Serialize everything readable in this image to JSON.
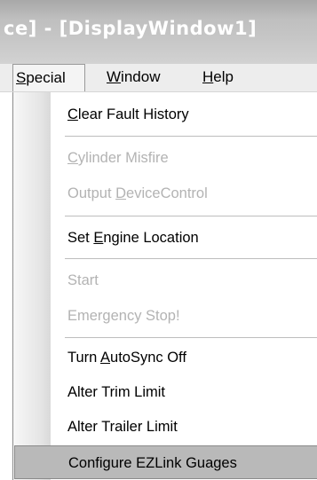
{
  "window": {
    "title": "ce] - [DisplayWindow1]"
  },
  "menubar": {
    "items": [
      {
        "pre": "",
        "ul": "S",
        "post": "pecial"
      },
      {
        "pre": "",
        "ul": "W",
        "post": "indow"
      },
      {
        "pre": "",
        "ul": "H",
        "post": "elp"
      }
    ]
  },
  "menu": {
    "items": [
      {
        "pre": "",
        "ul": "C",
        "post": "lear Fault History",
        "enabled": true
      },
      {
        "pre": "",
        "ul": "C",
        "post": "ylinder Misfire",
        "enabled": false
      },
      {
        "pre": "Output ",
        "ul": "D",
        "post": "eviceControl",
        "enabled": false
      },
      {
        "pre": "Set ",
        "ul": "E",
        "post": "ngine Location",
        "enabled": true
      },
      {
        "pre": "",
        "ul": "",
        "post": "Start",
        "enabled": false
      },
      {
        "pre": "",
        "ul": "",
        "post": "Emergency Stop!",
        "enabled": false
      },
      {
        "pre": "Turn ",
        "ul": "A",
        "post": "utoSync Off",
        "enabled": true
      },
      {
        "pre": "",
        "ul": "",
        "post": "Alter Trim Limit",
        "enabled": true
      },
      {
        "pre": "",
        "ul": "",
        "post": "Alter Trailer Limit",
        "enabled": true
      },
      {
        "pre": "",
        "ul": "",
        "post": "Configure EZLink Guages",
        "enabled": true,
        "highlighted": true
      }
    ]
  }
}
